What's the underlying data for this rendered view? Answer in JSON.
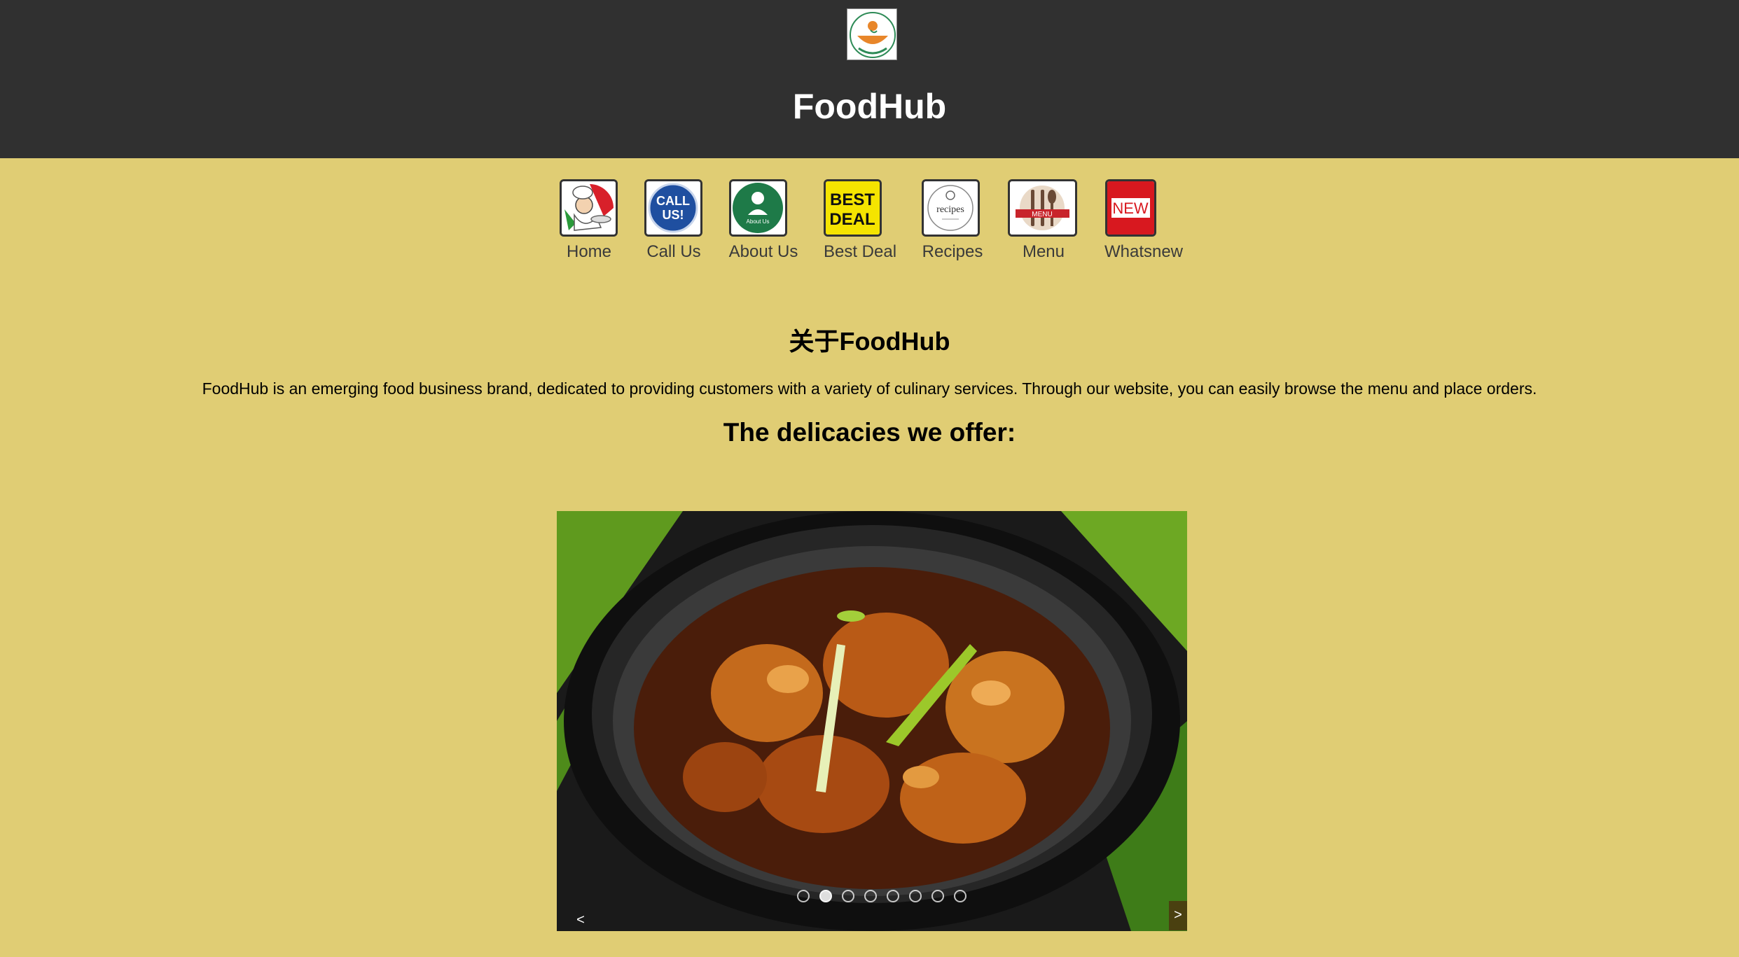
{
  "header": {
    "title": "FoodHub",
    "logo_icon": "foodhub-shareats-logo"
  },
  "nav": {
    "items": [
      {
        "label": "Home",
        "icon": "chef-icon"
      },
      {
        "label": "Call Us",
        "icon": "call-us-icon"
      },
      {
        "label": "About Us",
        "icon": "about-us-icon"
      },
      {
        "label": "Best Deal",
        "icon": "best-deal-icon"
      },
      {
        "label": "Recipes",
        "icon": "recipes-icon"
      },
      {
        "label": "Menu",
        "icon": "menu-icon"
      },
      {
        "label": "Whatsnew",
        "icon": "new-icon"
      }
    ]
  },
  "about": {
    "heading": "关于FoodHub",
    "text": "FoodHub is an emerging food business brand, dedicated to providing customers with a variety of culinary services. Through our website, you can easily browse the menu and place orders."
  },
  "offer": {
    "heading": "The delicacies we offer:"
  },
  "slideshow": {
    "slide_count": 8,
    "active_slide": 2,
    "prev_label": "<",
    "next_label": ">"
  },
  "colors": {
    "header_bg": "#303030",
    "page_bg": "#e0cd74",
    "title_color": "#ffffff"
  }
}
